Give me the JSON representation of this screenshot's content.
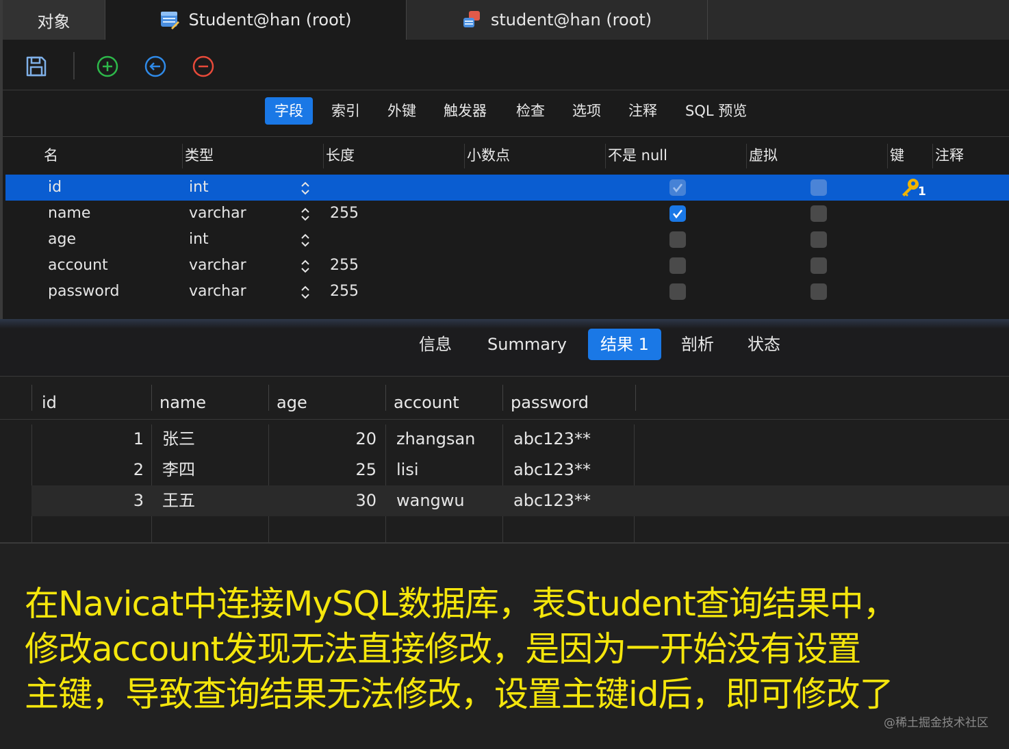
{
  "window_tabs": {
    "objects": "对象",
    "tab1": "Student@han (root)",
    "tab2": "student@han (root)"
  },
  "toolbar": {
    "save": "save-icon",
    "add": "plus-circle-icon",
    "insert": "arrow-left-circle-icon",
    "remove": "minus-circle-icon"
  },
  "designer_tabs": [
    "字段",
    "索引",
    "外键",
    "触发器",
    "检查",
    "选项",
    "注释",
    "SQL 预览"
  ],
  "fields": {
    "headers": [
      "名",
      "类型",
      "长度",
      "小数点",
      "不是 null",
      "虚拟",
      "键",
      "注释"
    ],
    "rows": [
      {
        "name": "id",
        "type": "int",
        "length": "",
        "not_null": true,
        "virtual": false,
        "key": "1"
      },
      {
        "name": "name",
        "type": "varchar",
        "length": "255",
        "not_null": true,
        "virtual": false,
        "key": ""
      },
      {
        "name": "age",
        "type": "int",
        "length": "",
        "not_null": false,
        "virtual": false,
        "key": ""
      },
      {
        "name": "account",
        "type": "varchar",
        "length": "255",
        "not_null": false,
        "virtual": false,
        "key": ""
      },
      {
        "name": "password",
        "type": "varchar",
        "length": "255",
        "not_null": false,
        "virtual": false,
        "key": ""
      }
    ]
  },
  "result_tabs": [
    "信息",
    "Summary",
    "结果 1",
    "剖析",
    "状态"
  ],
  "results": {
    "headers": [
      "id",
      "name",
      "age",
      "account",
      "password"
    ],
    "rows": [
      {
        "id": "1",
        "name": "张三",
        "age": "20",
        "account": "zhangsan",
        "password": "abc123**"
      },
      {
        "id": "2",
        "name": "李四",
        "age": "25",
        "account": "lisi",
        "password": "abc123**"
      },
      {
        "id": "3",
        "name": "王五",
        "age": "30",
        "account": "wangwu",
        "password": "abc123**"
      }
    ]
  },
  "caption": {
    "line1": "在Navicat中连接MySQL数据库，表Student查询结果中，",
    "line2": "修改account发现无法直接修改，是因为一开始没有设置",
    "line3": "主键，导致查询结果无法修改，设置主键id后，即可修改了"
  },
  "watermark": "@稀土掘金技术社区",
  "colors": {
    "accent": "#1a78e6",
    "selection": "#0a5dd1",
    "caption_text": "#f5e60c",
    "key_icon": "#f0b400"
  }
}
